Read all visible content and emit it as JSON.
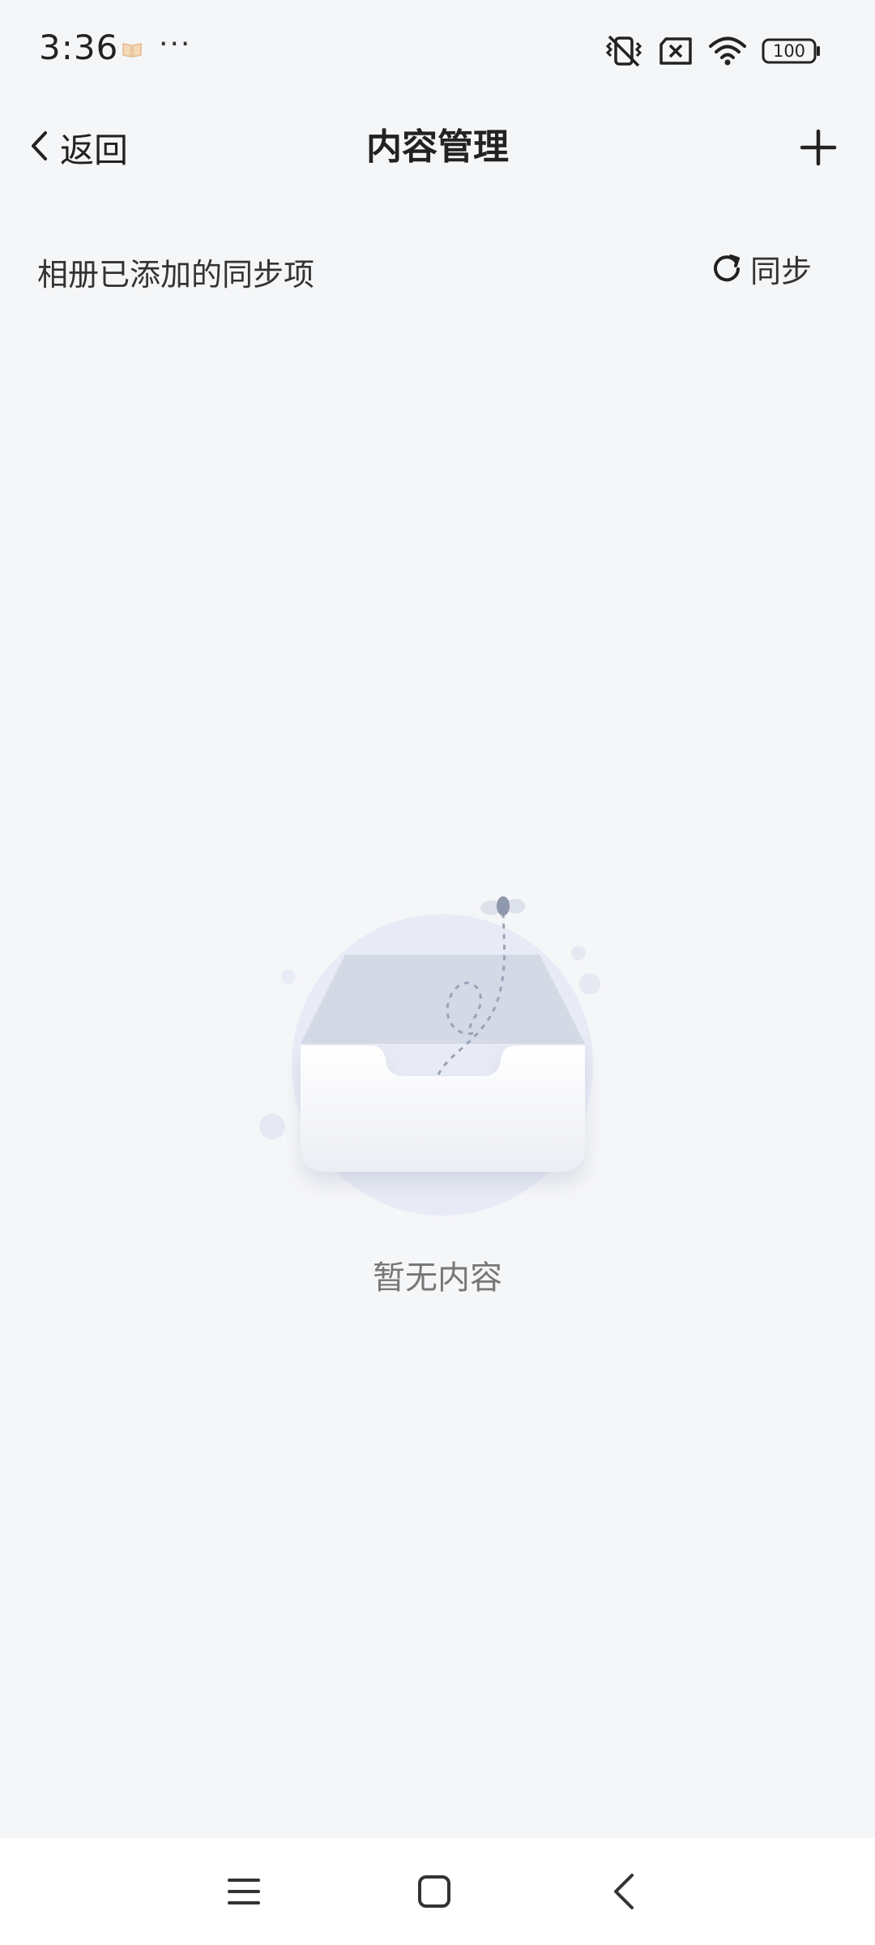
{
  "status_bar": {
    "time": "3:36",
    "more_indicator": "···",
    "battery": "100",
    "icons": [
      "notification-book-icon",
      "mute-vibrate-icon",
      "sim-disabled-icon",
      "wifi-icon",
      "battery-icon"
    ]
  },
  "nav": {
    "back_label": "返回",
    "title": "内容管理",
    "icons": [
      "chevron-left-icon",
      "plus-icon"
    ]
  },
  "sync_section": {
    "title": "相册已添加的同步项",
    "sync_label": "同步",
    "icon": "refresh-icon"
  },
  "empty_state": {
    "message": "暂无内容",
    "icon": "empty-inbox-illustration"
  },
  "system_nav": {
    "icons": [
      "menu-icon",
      "home-icon",
      "back-icon"
    ]
  },
  "colors": {
    "background": "#f5f6f8",
    "text_primary": "#222222",
    "text_muted": "#777777",
    "illustration_circle": "#e8ebf5",
    "illustration_tray_back": "#d4d9e6"
  }
}
